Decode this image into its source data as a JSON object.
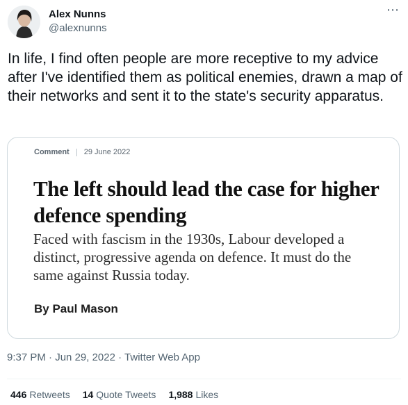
{
  "author": {
    "name": "Alex Nunns",
    "handle": "@alexnunns"
  },
  "menu_icon": "more-horizontal-icon",
  "tweet_text": "In life, I find often people are more receptive to my advice after I've identified them as political enemies, drawn a map of their networks and sent it to the state's security apparatus.",
  "card": {
    "kind": "Comment",
    "date": "29 June 2022",
    "headline": "The left should lead the case for higher defence spending",
    "standfirst": "Faced with fascism in the 1930s, Labour developed a distinct, progressive agenda on defence. It must do the same against Russia today.",
    "byline": "By Paul Mason"
  },
  "meta": {
    "time": "9:37 PM",
    "date": "Jun 29, 2022",
    "source": "Twitter Web App"
  },
  "stats": {
    "retweets": {
      "count": "446",
      "label": "Retweets"
    },
    "quotes": {
      "count": "14",
      "label": "Quote Tweets"
    },
    "likes": {
      "count": "1,988",
      "label": "Likes"
    }
  }
}
